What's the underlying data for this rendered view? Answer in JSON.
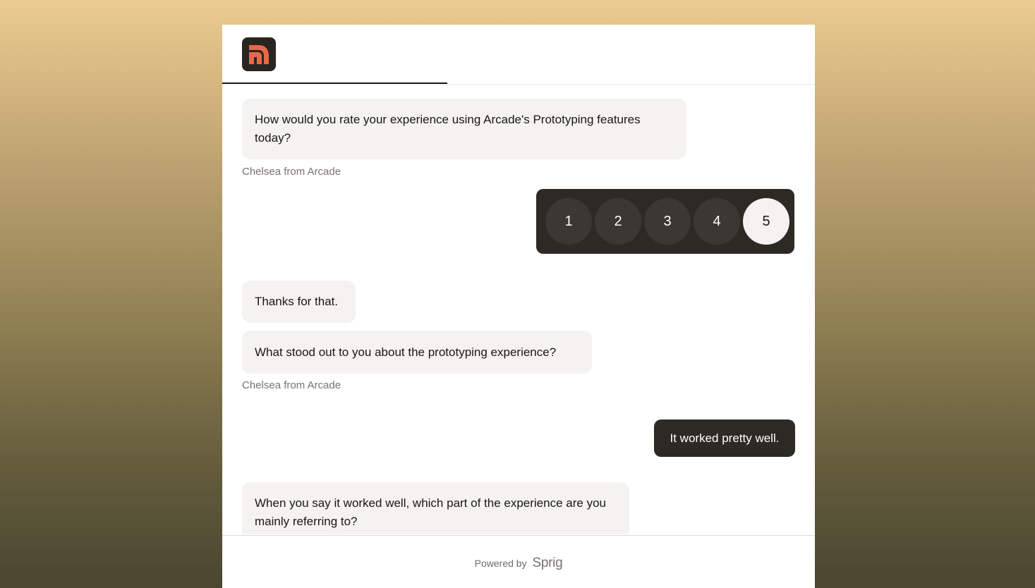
{
  "colors": {
    "accent": "#e8694a",
    "dark": "#2d2925",
    "bubble": "#f4f3f1"
  },
  "logo": {
    "icon": "arcade-logo-icon"
  },
  "progress": {
    "value": 0.38
  },
  "messages": {
    "q1": "How would you rate your experience using Arcade's Prototyping features today?",
    "sender1": "Chelsea from Arcade",
    "rating_options": [
      "1",
      "2",
      "3",
      "4",
      "5"
    ],
    "rating_selected": "5",
    "thanks": "Thanks for that.",
    "q2": "What stood out to you about the prototyping experience?",
    "sender2": "Chelsea from Arcade",
    "reply": "It worked pretty well.",
    "q3": "When you say it worked well, which part of the experience are you mainly referring to?"
  },
  "footer": {
    "powered_by": "Powered by",
    "brand": "Sprig"
  }
}
